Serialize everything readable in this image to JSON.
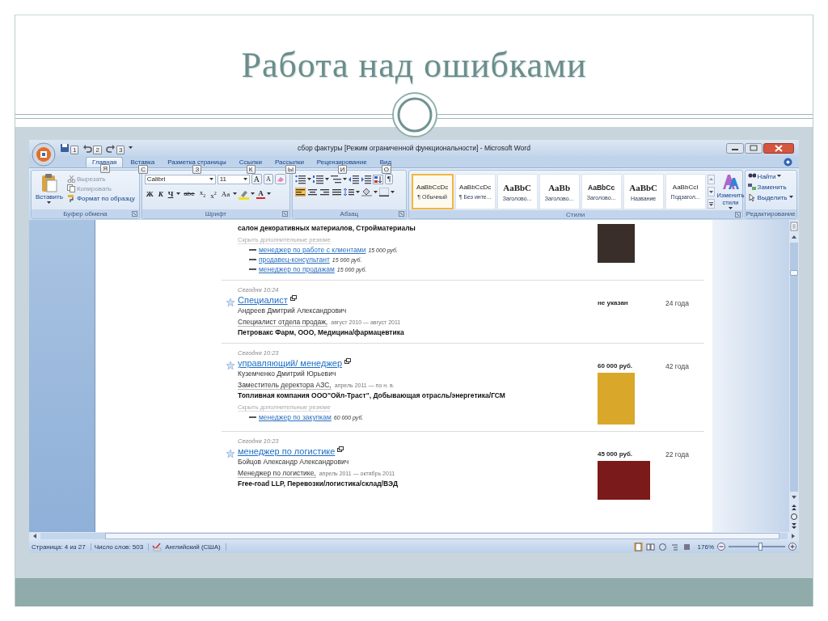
{
  "slide": {
    "title": "Работа над ошибками"
  },
  "window": {
    "quick_access": [
      {
        "kind": "save",
        "keytip": "1"
      },
      {
        "kind": "undo",
        "keytip": "2"
      },
      {
        "kind": "redo",
        "keytip": "3"
      }
    ],
    "title": "сбор фактуры [Режим ограниченной функциональности] - Microsoft Word"
  },
  "tabs": [
    {
      "label": "Главная",
      "keytip": "Я",
      "selected": true
    },
    {
      "label": "Вставка",
      "keytip": "С",
      "selected": false
    },
    {
      "label": "Разметка страницы",
      "keytip": "З",
      "selected": false
    },
    {
      "label": "Ссылки",
      "keytip": "К",
      "selected": false
    },
    {
      "label": "Рассылки",
      "keytip": "Ы",
      "selected": false
    },
    {
      "label": "Рецензирование",
      "keytip": "И",
      "selected": false
    },
    {
      "label": "Вид",
      "keytip": "О",
      "selected": false
    }
  ],
  "ribbon": {
    "clipboard": {
      "label": "Буфер обмена",
      "paste": "Вставить",
      "commands": [
        {
          "kind": "cut",
          "label": "Вырезать",
          "disabled": true
        },
        {
          "kind": "copy",
          "label": "Копировать",
          "disabled": true
        },
        {
          "kind": "format",
          "label": "Формат по образцу",
          "disabled": false
        }
      ]
    },
    "font": {
      "label": "Шрифт",
      "font_name": "Calibri",
      "font_size": "11",
      "size_buttons": [
        {
          "kind": "grow",
          "text": "A"
        },
        {
          "kind": "shrink",
          "text": "A"
        }
      ],
      "format_buttons": [
        {
          "kind": "bold",
          "text": "Ж"
        },
        {
          "kind": "italic",
          "text": "К"
        },
        {
          "kind": "underline",
          "text": "Ч"
        },
        {
          "kind": "strike",
          "text": "abe"
        },
        {
          "kind": "sub",
          "text": "x$_{2}$"
        },
        {
          "kind": "sup",
          "text": "x$^{2}$"
        },
        {
          "kind": "case",
          "text": "Aa"
        }
      ],
      "color_button": "A"
    },
    "paragraph": {
      "label": "Абзац",
      "pilcrow": "¶",
      "alignments": [
        {
          "kind": "left",
          "selected": true
        },
        {
          "kind": "center",
          "selected": false
        },
        {
          "kind": "right",
          "selected": false
        },
        {
          "kind": "justify",
          "selected": false
        }
      ]
    },
    "styles": {
      "label": "Стили",
      "items": [
        {
          "kind": "plain",
          "preview": "AaBbCcDc",
          "name": "¶ Обычный",
          "selected": true
        },
        {
          "kind": "plain",
          "preview": "AaBbCcDc",
          "name": "¶ Без инте...",
          "selected": false
        },
        {
          "kind": "heading",
          "preview": "AaBbC",
          "name": "Заголово...",
          "selected": false
        },
        {
          "kind": "heading",
          "preview": "AaBb",
          "name": "Заголово...",
          "selected": false
        },
        {
          "kind": "bold",
          "preview": "AaBbCc",
          "name": "Заголово...",
          "selected": false
        },
        {
          "kind": "heading",
          "preview": "AaBbC",
          "name": "Название",
          "selected": false
        },
        {
          "kind": "plain",
          "preview": "AaBbCcI",
          "name": "Подзагол...",
          "selected": false
        }
      ],
      "change": "Изменить стили"
    },
    "editing": {
      "label": "Редактирование",
      "commands": [
        {
          "kind": "find",
          "label": "Найти",
          "menu": true
        },
        {
          "kind": "replace",
          "label": "Заменить",
          "menu": false
        },
        {
          "kind": "select",
          "label": "Выделить",
          "menu": true
        }
      ]
    }
  },
  "document": {
    "entries": [
      {
        "kind": "continued",
        "company": "салон декоративных материалов, Стройматериалы",
        "hide_link": "Скрыть дополнительные резюме",
        "more": [
          {
            "title": "менеджер по работе с клиентами",
            "salary": "15 000 руб."
          },
          {
            "title": "продавец-консультант",
            "salary": "15 000 руб."
          },
          {
            "title": "менеджер по продажам",
            "salary": "15 000 руб."
          }
        ],
        "photo": {
          "kind": "tall"
        }
      },
      {
        "kind": "full",
        "date": "Сегодня 10:24",
        "title": "Специалист",
        "name": "Андреев Дмитрий Александрович",
        "position": "Специалист отдела продаж,",
        "period": "август 2010 — август 2011",
        "company": "Петровакс Фарм, ООО, Медицина/фармацевтика",
        "salary": "не указан",
        "age": "24 года"
      },
      {
        "kind": "full",
        "date": "Сегодня 10:23",
        "title": "управляющий/ менеджер",
        "name": "Куземченко Дмитрий Юрьевич",
        "position": "Заместитель деректора АЗС,",
        "period": "апрель 2011 — по н. в.",
        "company": "Топливная компания ООО\"Ойл-Траст\", Добывающая отрасль/энергетика/ГСМ",
        "hide_link": "Скрыть дополнительные резюме",
        "more": [
          {
            "title": "менеджер по закупкам",
            "salary": "60 000 руб."
          }
        ],
        "salary": "60 000 руб.",
        "age": "42 года",
        "photo": {
          "kind": "tall"
        }
      },
      {
        "kind": "full",
        "date": "Сегодня 10:23",
        "title": "менеджер по логистике",
        "name": "Бойцов Александр Александрович",
        "position": "Менеджер по логистике,",
        "period": "апрель 2011 — октябрь 2011",
        "company": "Free-road LLP, Перевозки/логистика/склад/ВЭД",
        "salary": "45 000 руб.",
        "age": "22 года",
        "photo": {
          "kind": "wide"
        }
      }
    ]
  },
  "status_bar": {
    "page": "Страница: 4 из 27",
    "words": "Число слов: 503",
    "language": "Английский (США)",
    "views": [
      {
        "kind": "print",
        "selected": true
      },
      {
        "kind": "reading",
        "selected": false
      },
      {
        "kind": "web",
        "selected": false
      },
      {
        "kind": "outline",
        "selected": false
      },
      {
        "kind": "draft",
        "selected": false
      }
    ],
    "zoom": "176%",
    "zoom_slider": {
      "level": 0.55
    }
  }
}
